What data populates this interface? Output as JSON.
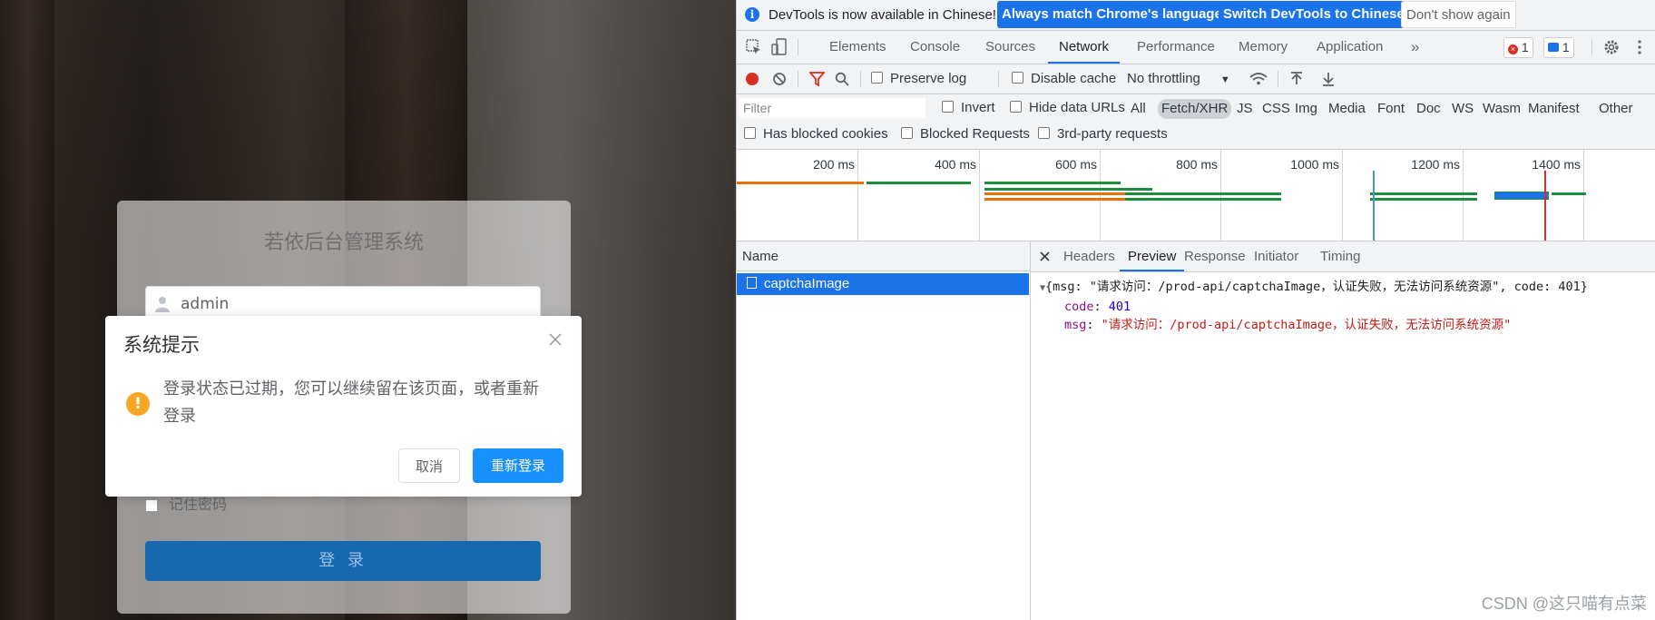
{
  "app": {
    "login_title": "若依后台管理系统",
    "username_value": "admin",
    "remember_label": "记住密码",
    "login_button": "登 录"
  },
  "dialog": {
    "title": "系统提示",
    "message": "登录状态已过期，您可以继续留在该页面，或者重新登录",
    "cancel": "取消",
    "relogin": "重新登录"
  },
  "devtools": {
    "infobar": {
      "text": "DevTools is now available in Chinese!",
      "btn_match": "Always match Chrome's language",
      "btn_switch": "Switch DevTools to Chinese",
      "btn_dont": "Don't show again"
    },
    "tabs": [
      "Elements",
      "Console",
      "Sources",
      "Network",
      "Performance",
      "Memory",
      "Application"
    ],
    "active_tab": "Network",
    "error_count": "1",
    "message_count": "1",
    "toolbar": {
      "preserve_log": "Preserve log",
      "disable_cache": "Disable cache",
      "throttling": "No throttling"
    },
    "filter": {
      "placeholder": "Filter",
      "invert": "Invert",
      "hide_data_urls": "Hide data URLs",
      "types": [
        "All",
        "Fetch/XHR",
        "JS",
        "CSS",
        "Img",
        "Media",
        "Font",
        "Doc",
        "WS",
        "Wasm",
        "Manifest",
        "Other"
      ],
      "selected_type": "Fetch/XHR",
      "blocked_cookies": "Has blocked cookies",
      "blocked_requests": "Blocked Requests",
      "third_party": "3rd-party requests"
    },
    "timeline_ticks": [
      "200 ms",
      "400 ms",
      "600 ms",
      "800 ms",
      "1000 ms",
      "1200 ms",
      "1400 ms"
    ],
    "name_header": "Name",
    "request_name": "captchaImage",
    "detail_tabs": [
      "Headers",
      "Preview",
      "Response",
      "Initiator",
      "Timing"
    ],
    "active_detail_tab": "Preview",
    "preview": {
      "summary": "{msg: \"请求访问：/prod-api/captchaImage，认证失败，无法访问系统资源\", code: 401}",
      "code_key": "code",
      "code_value": "401",
      "msg_key": "msg",
      "msg_value": "\"请求访问：/prod-api/captchaImage，认证失败，无法访问系统资源\""
    }
  },
  "watermark": "CSDN @这只喵有点菜",
  "colors": {
    "accent": "#1a73e8",
    "primary_button": "#1890ff",
    "warning": "#f5a623"
  }
}
